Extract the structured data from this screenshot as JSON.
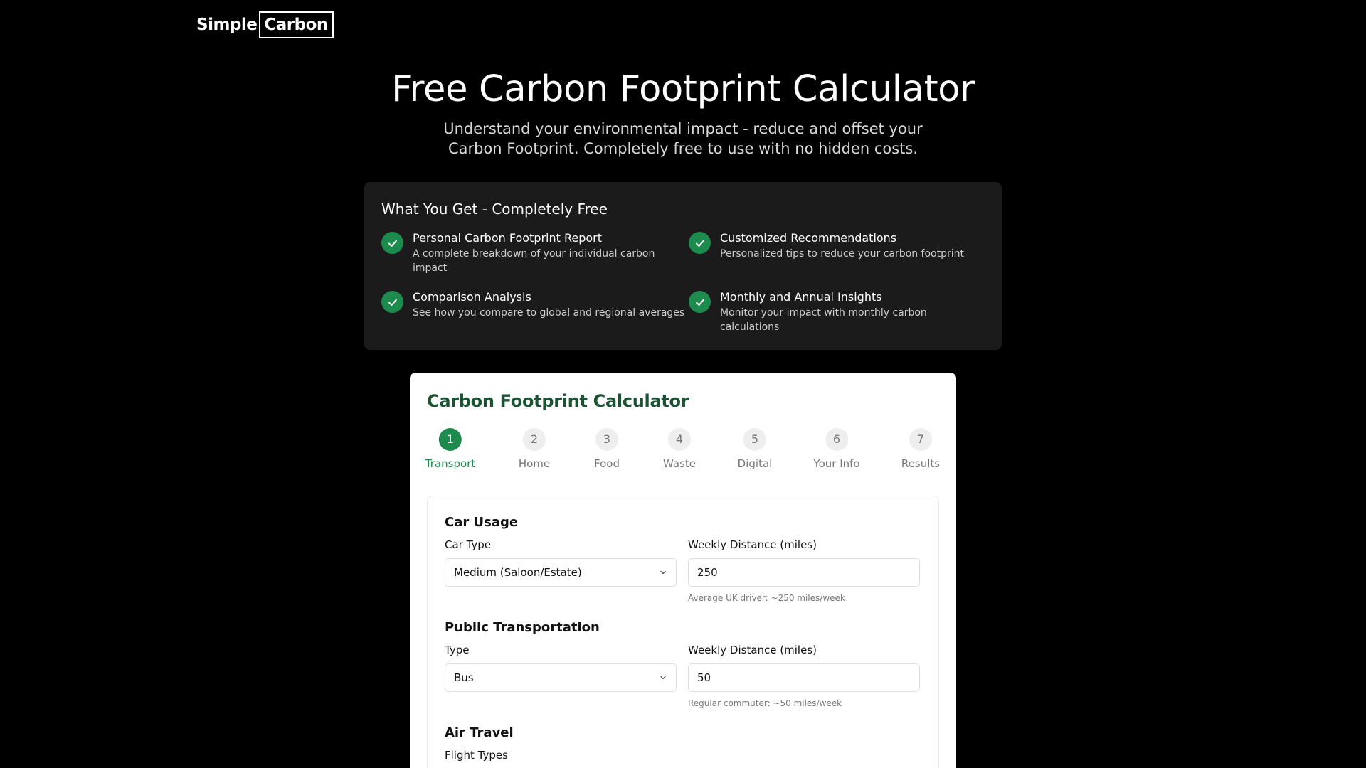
{
  "logo": {
    "part1": "Simple",
    "part2": "Carbon"
  },
  "hero": {
    "title": "Free Carbon Footprint Calculator",
    "subtitle": "Understand your environmental impact - reduce and offset your Carbon Footprint. Completely free to use with no hidden costs."
  },
  "features": {
    "heading": "What You Get - Completely Free",
    "items": [
      {
        "title": "Personal Carbon Footprint Report",
        "desc": "A complete breakdown of your individual carbon impact",
        "icon": "check-icon"
      },
      {
        "title": "Customized Recommendations",
        "desc": "Personalized tips to reduce your carbon footprint",
        "icon": "check-icon"
      },
      {
        "title": "Comparison Analysis",
        "desc": "See how you compare to global and regional averages",
        "icon": "check-icon"
      },
      {
        "title": "Monthly and Annual Insights",
        "desc": "Monitor your impact with monthly carbon calculations",
        "icon": "check-icon"
      }
    ]
  },
  "calculator": {
    "title": "Carbon Footprint Calculator",
    "steps": [
      {
        "num": "1",
        "label": "Transport",
        "active": true
      },
      {
        "num": "2",
        "label": "Home"
      },
      {
        "num": "3",
        "label": "Food"
      },
      {
        "num": "4",
        "label": "Waste"
      },
      {
        "num": "5",
        "label": "Digital"
      },
      {
        "num": "6",
        "label": "Your Info"
      },
      {
        "num": "7",
        "label": "Results"
      }
    ],
    "car": {
      "title": "Car Usage",
      "type_label": "Car Type",
      "type_value": "Medium (Saloon/Estate)",
      "distance_label": "Weekly Distance (miles)",
      "distance_value": "250",
      "hint": "Average UK driver: ~250 miles/week"
    },
    "public": {
      "title": "Public Transportation",
      "type_label": "Type",
      "type_value": "Bus",
      "distance_label": "Weekly Distance (miles)",
      "distance_value": "50",
      "hint": "Regular commuter: ~50 miles/week"
    },
    "air": {
      "title": "Air Travel",
      "types_label": "Flight Types"
    }
  },
  "colors": {
    "accent": "#1d8a4e",
    "title_green": "#1b5233",
    "card_dark": "#1b1b1b"
  }
}
